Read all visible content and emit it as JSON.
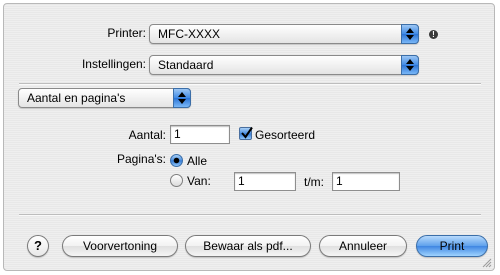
{
  "printer": {
    "label": "Printer:",
    "value": "MFC-XXXX"
  },
  "presets": {
    "label": "Instellingen:",
    "value": "Standaard"
  },
  "panel": {
    "value": "Aantal en pagina's"
  },
  "copies": {
    "label": "Aantal:",
    "value": "1",
    "collated_label": "Gesorteerd",
    "collated_checked": true
  },
  "pages": {
    "label": "Pagina's:",
    "all_label": "Alle",
    "from_label": "Van:",
    "from_value": "1",
    "to_label": "t/m:",
    "to_value": "1",
    "selected": "all"
  },
  "buttons": {
    "help": "?",
    "preview": "Voorvertoning",
    "save_pdf": "Bewaar als pdf...",
    "cancel": "Annuleer",
    "print": "Print"
  },
  "colors": {
    "accent": "#3f86e2",
    "window": "#ececec"
  },
  "icons": {
    "printer_info": "info-icon",
    "popup_arrows": "stepper-arrows-icon"
  }
}
